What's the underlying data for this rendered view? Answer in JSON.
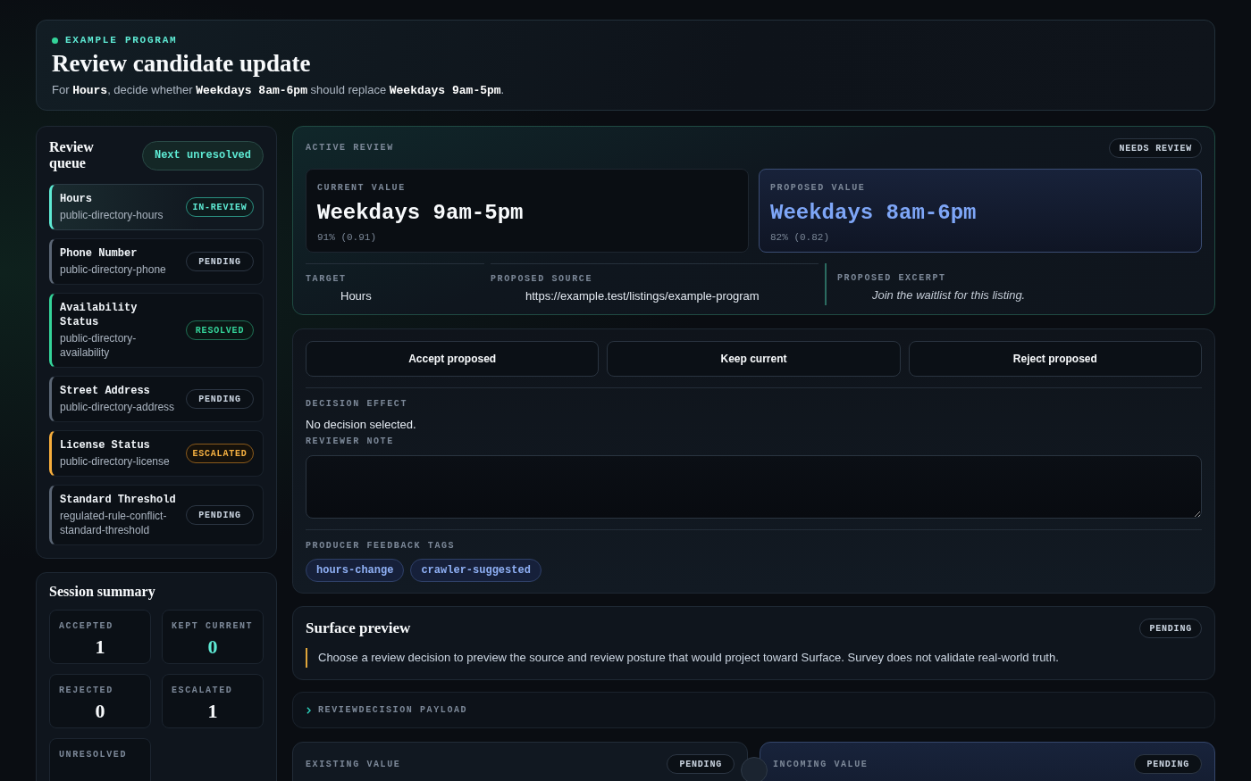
{
  "header": {
    "eyebrow": "EXAMPLE PROGRAM",
    "title": "Review candidate update",
    "summary": "For **Hours**, decide whether **Weekdays 8am-6pm** should replace **Weekdays 9am-5pm**."
  },
  "review_queue": {
    "title": "Review queue",
    "next_button": "Next unresolved",
    "items": [
      {
        "title": "Hours",
        "subtitle": "public-directory-hours",
        "badge": "IN-REVIEW",
        "kind": "active",
        "selected": true
      },
      {
        "title": "Phone Number",
        "subtitle": "public-directory-phone",
        "badge": "PENDING",
        "kind": "open",
        "selected": false
      },
      {
        "title": "Availability Status",
        "subtitle": "public-directory-availability",
        "badge": "RESOLVED",
        "kind": "done",
        "selected": false
      },
      {
        "title": "Street Address",
        "subtitle": "public-directory-address",
        "badge": "PENDING",
        "kind": "open",
        "selected": false
      },
      {
        "title": "License Status",
        "subtitle": "public-directory-license",
        "badge": "ESCALATED",
        "kind": "flagged",
        "selected": false
      },
      {
        "title": "Standard Threshold",
        "subtitle": "regulated-rule-conflict-standard-threshold",
        "badge": "PENDING",
        "kind": "open",
        "selected": false
      }
    ]
  },
  "session_summary": {
    "title": "Session summary",
    "stats": [
      {
        "label": "ACCEPTED",
        "value": "1",
        "color": "#f8fafc"
      },
      {
        "label": "KEPT CURRENT",
        "value": "0",
        "color": "#5eead4"
      },
      {
        "label": "REJECTED",
        "value": "0",
        "color": "#f8fafc"
      },
      {
        "label": "ESCALATED",
        "value": "1",
        "color": "#f8fafc"
      },
      {
        "label": "UNRESOLVED"
      }
    ]
  },
  "active_review": {
    "label": "ACTIVE REVIEW",
    "badge": "NEEDS REVIEW",
    "current": {
      "label": "CURRENT VALUE",
      "value": "Weekdays 9am-5pm",
      "confidence": "91% (0.91)"
    },
    "proposed": {
      "label": "PROPOSED VALUE",
      "value": "Weekdays 8am-6pm",
      "confidence": "82% (0.82)"
    },
    "details": [
      {
        "label": "TARGET",
        "value": "Hours",
        "kind": "plain"
      },
      {
        "label": "PROPOSED SOURCE",
        "value": "https://example.test/listings/example-program",
        "kind": "plain"
      },
      {
        "label": "PROPOSED EXCERPT",
        "value": "Join the waitlist for this listing.",
        "kind": "quote"
      }
    ]
  },
  "decision": {
    "buttons": [
      "Accept proposed",
      "Keep current",
      "Reject proposed"
    ],
    "effect_label": "DECISION EFFECT",
    "effect": "No decision selected.",
    "note_label": "REVIEWER NOTE",
    "tags_label": "PRODUCER FEEDBACK TAGS",
    "tags": [
      "hours-change",
      "crawler-suggested"
    ]
  },
  "surface_preview": {
    "title": "Surface preview",
    "badge": "PENDING",
    "note": "Choose a review decision to preview the source and review posture that would project toward Surface. Survey does not validate real-world truth."
  },
  "payload": {
    "label": "REVIEWDECISION PAYLOAD",
    "expanded": false
  },
  "comparison": [
    {
      "label": "EXISTING VALUE",
      "badge": "PENDING",
      "kind": "existing"
    },
    {
      "label": "INCOMING VALUE",
      "badge": "PENDING",
      "kind": "incoming"
    }
  ]
}
